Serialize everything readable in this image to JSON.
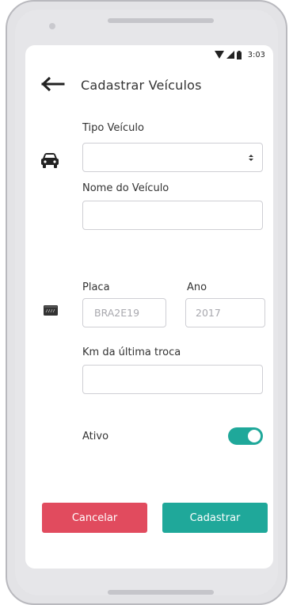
{
  "status_bar": {
    "time": "3:03"
  },
  "header": {
    "title": "Cadastrar Veículos"
  },
  "form": {
    "vehicle_type_label": "Tipo Veículo",
    "vehicle_type_value": "",
    "vehicle_name_label": "Nome do Veículo",
    "vehicle_name_value": "",
    "plate_label": "Placa",
    "plate_placeholder": "BRA2E19",
    "year_label": "Ano",
    "year_placeholder": "2017",
    "km_label": "Km da última troca",
    "km_value": "",
    "active_label": "Ativo",
    "active_on": true
  },
  "actions": {
    "cancel_label": "Cancelar",
    "submit_label": "Cadastrar"
  },
  "colors": {
    "accent": "#1fa89a",
    "danger": "#e14b5e",
    "text": "#333333",
    "border": "#cfcfd4"
  },
  "icons": [
    "wifi-icon",
    "signal-icon",
    "battery-icon",
    "back-arrow-icon",
    "car-icon",
    "plate-icon",
    "select-caret-icon"
  ]
}
